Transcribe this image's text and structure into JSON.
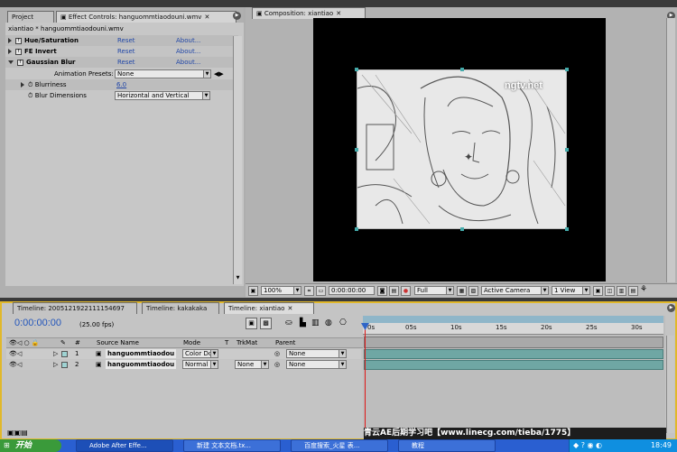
{
  "project_tab": "Project",
  "effect_controls_tab": "Effect Controls: hanguommtiaodouni.wmv",
  "composition_tab": "Composition: xiantiao",
  "effect_subtitle": "xiantiao * hanguommtiaodouni.wmv",
  "effects": [
    {
      "name": "Hue/Saturation",
      "reset": "Reset",
      "about": "About..."
    },
    {
      "name": "FE Invert",
      "reset": "Reset",
      "about": "About..."
    },
    {
      "name": "Gaussian Blur",
      "reset": "Reset",
      "about": "About..."
    }
  ],
  "animation_presets_label": "Animation Presets:",
  "animation_presets_value": "None",
  "blurriness_label": "Blurriness",
  "blurriness_value": "6.0",
  "blur_dimensions_label": "Blur Dimensions",
  "blur_dimensions_value": "Horizontal and Vertical",
  "watermark": "ngtv.net",
  "comp_toolbar": {
    "zoom": "100%",
    "timecode": "0:00:00:00",
    "resolution": "Full",
    "camera": "Active Camera",
    "view": "1 View"
  },
  "timeline_tabs": [
    "Timeline: 2005121922111154697",
    "Timeline: kakakaka",
    "Timeline: xiantiao"
  ],
  "current_time": "0:00:00:00",
  "fps": "(25.00 fps)",
  "columns": {
    "source_name": "Source Name",
    "mode": "Mode",
    "t": "T",
    "trkmat": "TrkMat",
    "parent": "Parent"
  },
  "layers": [
    {
      "num": "1",
      "name": "hanguommtiaodou",
      "mode": "Color Dc",
      "trkmat": "",
      "parent": "None"
    },
    {
      "num": "2",
      "name": "hanguommtiaodou",
      "mode": "Normal",
      "trkmat": "None",
      "parent": "None"
    }
  ],
  "ruler_labels": [
    "0s",
    "05s",
    "10s",
    "15s",
    "20s",
    "25s",
    "30s"
  ],
  "footer_banner": "青云AE后期学习吧【www.linecg.com/tieba/1775】",
  "taskbar": {
    "start": "开始",
    "items": [
      "Adobe After Effe...",
      "新建 文本文档.tx...",
      "百度搜索_火星 表...",
      "教程"
    ],
    "clock": "18:49"
  }
}
